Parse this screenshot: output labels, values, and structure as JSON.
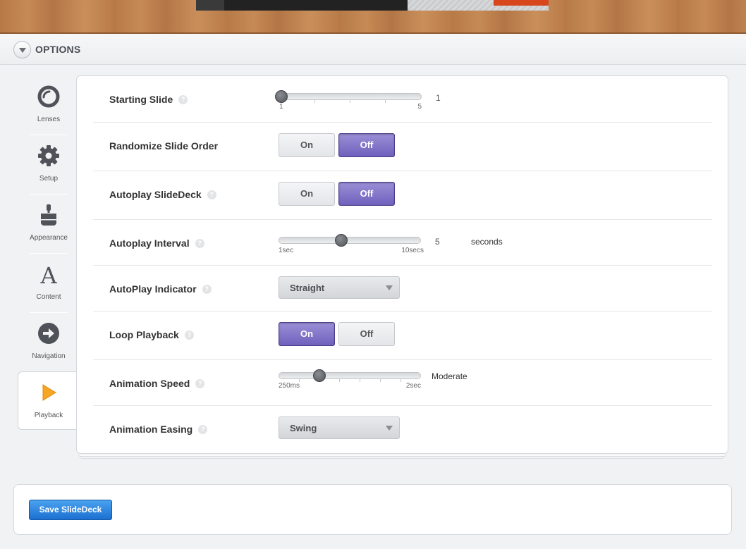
{
  "header": {
    "title": "OPTIONS"
  },
  "nav": {
    "items": [
      {
        "label": "Lenses"
      },
      {
        "label": "Setup"
      },
      {
        "label": "Appearance"
      },
      {
        "label": "Content"
      },
      {
        "label": "Navigation"
      },
      {
        "label": "Playback"
      }
    ],
    "active": "Playback"
  },
  "options": {
    "starting_slide": {
      "label": "Starting Slide",
      "min": "1",
      "max": "5",
      "value": "1",
      "fraction": 0.0
    },
    "randomize": {
      "label": "Randomize Slide Order",
      "on": "On",
      "off": "Off",
      "selected": "Off"
    },
    "autoplay": {
      "label": "Autoplay SlideDeck",
      "on": "On",
      "off": "Off",
      "selected": "Off"
    },
    "autoplay_interval": {
      "label": "Autoplay Interval",
      "min": "1sec",
      "max": "10secs",
      "value": "5",
      "unit": "seconds",
      "fraction": 0.444
    },
    "autoplay_indicator": {
      "label": "AutoPlay Indicator",
      "selected": "Straight"
    },
    "loop": {
      "label": "Loop Playback",
      "on": "On",
      "off": "Off",
      "selected": "On"
    },
    "animation_speed": {
      "label": "Animation Speed",
      "min": "250ms",
      "max": "2sec",
      "value": "Moderate",
      "fraction": 0.286
    },
    "animation_easing": {
      "label": "Animation Easing",
      "selected": "Swing"
    }
  },
  "help_glyph": "?",
  "save": {
    "label": "Save SlideDeck"
  },
  "colors": {
    "accent_purple": "#7a6cc4",
    "save_blue": "#2a7fdc"
  }
}
